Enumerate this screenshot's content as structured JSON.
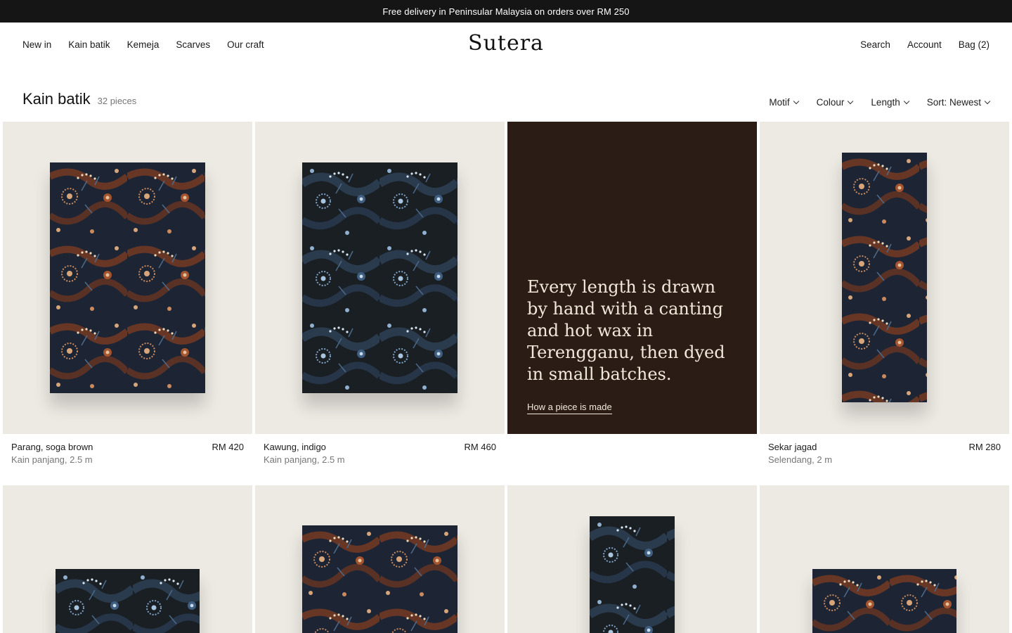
{
  "announcement": "Free delivery in Peninsular Malaysia on orders over RM 250",
  "brand": "Sutera",
  "nav": {
    "left": [
      "New in",
      "Kain batik",
      "Kemeja",
      "Scarves",
      "Our craft"
    ],
    "right": {
      "search": "Search",
      "account": "Account",
      "bag": "Bag (2)"
    }
  },
  "collection": {
    "title": "Kain batik",
    "count": "32 pieces"
  },
  "filters": {
    "motif": "Motif",
    "colour": "Colour",
    "length": "Length",
    "sort": "Sort: Newest"
  },
  "products": [
    {
      "name": "Parang, soga brown",
      "price": "RM 420",
      "detail": "Kain panjang, 2.5 m",
      "palette": "brown"
    },
    {
      "name": "Kawung, indigo",
      "price": "RM 460",
      "detail": "Kain panjang, 2.5 m",
      "palette": "indigo"
    },
    {
      "name": "Sekar jagad",
      "price": "RM 280",
      "detail": "Selendang, 2 m",
      "palette": "brown"
    }
  ],
  "story": {
    "quote": "Every length is drawn by hand with a canting and hot wax in Terengganu, then dyed in small batches.",
    "link": "How a piece is made"
  },
  "second_row_palettes": [
    "indigo",
    "brown",
    "indigo",
    "brown"
  ],
  "colors": {
    "announcement_bg": "#151515",
    "tile_bg": "#ede9e3",
    "story_bg": "#2b1d16",
    "story_text": "#f1e8da",
    "batik_ground": "#1f2b3d",
    "soga_brown": "#8a4326",
    "indigo_blue": "#3f5f82"
  }
}
